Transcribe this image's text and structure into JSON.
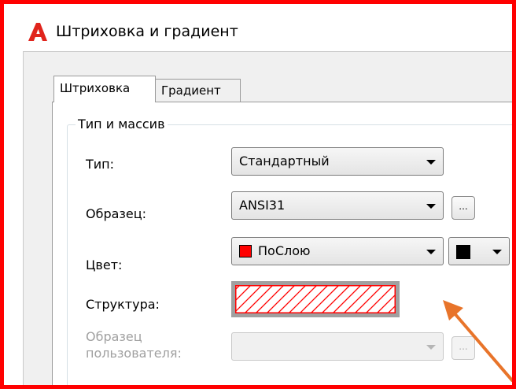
{
  "window": {
    "title": "Штриховка и градиент"
  },
  "tabs": [
    {
      "label": "Штриховка",
      "active": true
    },
    {
      "label": "Градиент",
      "active": false
    }
  ],
  "group": {
    "title": "Тип и массив"
  },
  "fields": {
    "type": {
      "label": "Тип:",
      "value": "Стандартный"
    },
    "pattern": {
      "label": "Образец:",
      "value": "ANSI31",
      "browse_label": "..."
    },
    "color": {
      "label": "Цвет:",
      "value": "ПоСлою",
      "swatch": "#ff0000",
      "background_swatch": "#000000"
    },
    "swatch": {
      "label": "Структура:",
      "stroke": "#ff0000"
    },
    "custom_pattern": {
      "label_line1": "Образец",
      "label_line2": "пользователя:",
      "value": "",
      "browse_label": "..."
    }
  },
  "annotation": {
    "arrow_color": "#e8742a",
    "frame_color": "#ff0000"
  }
}
